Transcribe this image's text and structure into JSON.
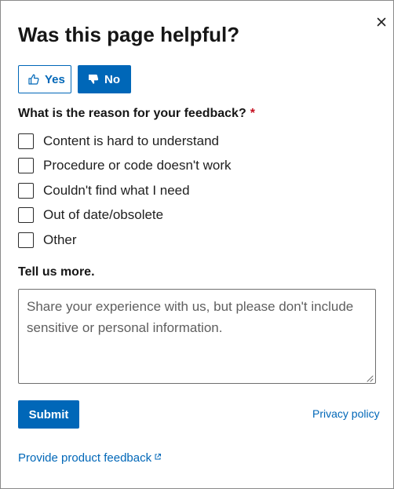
{
  "dialog": {
    "title": "Was this page helpful?",
    "close_icon": "close-icon"
  },
  "vote": {
    "yes_label": "Yes",
    "yes_icon": "thumbs-up-icon",
    "no_label": "No",
    "no_icon": "thumbs-down-icon",
    "selected": "No"
  },
  "reason": {
    "question": "What is the reason for your feedback?",
    "required_mark": "*",
    "options": [
      {
        "label": "Content is hard to understand",
        "checked": false
      },
      {
        "label": "Procedure or code doesn't work",
        "checked": false
      },
      {
        "label": "Couldn't find what I need",
        "checked": false
      },
      {
        "label": "Out of date/obsolete",
        "checked": false
      },
      {
        "label": "Other",
        "checked": false
      }
    ]
  },
  "more": {
    "label": "Tell us more.",
    "placeholder": "Share your experience with us, but please don't include sensitive or personal information.",
    "value": ""
  },
  "actions": {
    "submit_label": "Submit",
    "privacy_label": "Privacy policy",
    "product_feedback_label": "Provide product feedback",
    "external_icon": "external-link-icon"
  },
  "colors": {
    "accent": "#0067b8",
    "required": "#c50f1f",
    "text": "#161616"
  }
}
